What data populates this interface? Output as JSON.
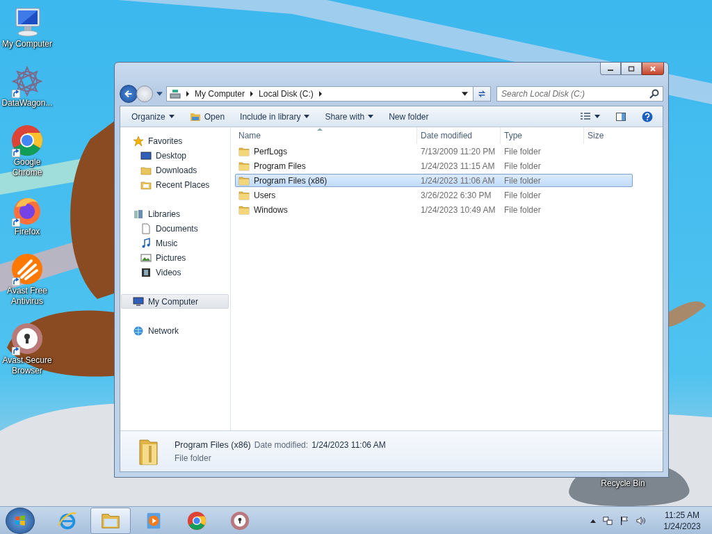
{
  "desktop_icons": [
    {
      "label": "My Computer",
      "kind": "computer",
      "shortcut": false
    },
    {
      "label": "DataWagon...",
      "kind": "datawagon",
      "shortcut": true
    },
    {
      "label": "Google Chrome",
      "kind": "chrome",
      "shortcut": true
    },
    {
      "label": "Firefox",
      "kind": "firefox",
      "shortcut": true
    },
    {
      "label": "Avast Free Antivirus",
      "kind": "avast",
      "shortcut": true
    },
    {
      "label": "Avast Secure Browser",
      "kind": "avast-browser",
      "shortcut": true
    }
  ],
  "recycle_bin": {
    "label": "Recycle Bin"
  },
  "window": {
    "address": {
      "segments": [
        "My Computer",
        "Local Disk (C:)"
      ]
    },
    "search": {
      "placeholder": "Search Local Disk (C:)"
    },
    "toolbar": [
      {
        "label": "Organize",
        "kind": "menu"
      },
      {
        "label": "Open",
        "kind": "open"
      },
      {
        "label": "Include in library",
        "kind": "menu"
      },
      {
        "label": "Share with",
        "kind": "menu"
      },
      {
        "label": "New folder",
        "kind": "plain"
      }
    ],
    "nav": [
      {
        "label": "Favorites",
        "kind": "star",
        "selected": false,
        "children": [
          {
            "label": "Desktop",
            "kind": "desktop",
            "selected": false
          },
          {
            "label": "Downloads",
            "kind": "downloads",
            "selected": false
          },
          {
            "label": "Recent Places",
            "kind": "recent",
            "selected": false
          }
        ]
      },
      {
        "label": "Libraries",
        "kind": "library",
        "selected": false,
        "children": [
          {
            "label": "Documents",
            "kind": "documents",
            "selected": false
          },
          {
            "label": "Music",
            "kind": "music",
            "selected": false
          },
          {
            "label": "Pictures",
            "kind": "pictures",
            "selected": false
          },
          {
            "label": "Videos",
            "kind": "videos",
            "selected": false
          }
        ]
      },
      {
        "label": "My Computer",
        "kind": "computer",
        "selected": true
      },
      {
        "label": "Network",
        "kind": "network",
        "selected": false
      }
    ],
    "columns": [
      {
        "label": "Name",
        "sorted": true
      },
      {
        "label": "Date modified",
        "sorted": false
      },
      {
        "label": "Type",
        "sorted": false
      },
      {
        "label": "Size",
        "sorted": false
      }
    ],
    "rows": [
      {
        "name": "PerfLogs",
        "date": "7/13/2009 11:20 PM",
        "type": "File folder",
        "selected": false
      },
      {
        "name": "Program Files",
        "date": "1/24/2023 11:15 AM",
        "type": "File folder",
        "selected": false
      },
      {
        "name": "Program Files (x86)",
        "date": "1/24/2023 11:06 AM",
        "type": "File folder",
        "selected": true
      },
      {
        "name": "Users",
        "date": "3/26/2022 6:30 PM",
        "type": "File folder",
        "selected": false
      },
      {
        "name": "Windows",
        "date": "1/24/2023 10:49 AM",
        "type": "File folder",
        "selected": false
      }
    ],
    "details": {
      "name": "Program Files (x86)",
      "date_label": "Date modified:",
      "date": "1/24/2023 11:06 AM",
      "type": "File folder"
    }
  },
  "taskbar": {
    "apps": [
      {
        "kind": "ie",
        "active": false
      },
      {
        "kind": "explorer",
        "active": true
      },
      {
        "kind": "media",
        "active": false
      },
      {
        "kind": "chrome",
        "active": false
      },
      {
        "kind": "avast-browser",
        "active": false
      }
    ],
    "clock": {
      "time": "11:25 AM",
      "date": "1/24/2023"
    }
  }
}
